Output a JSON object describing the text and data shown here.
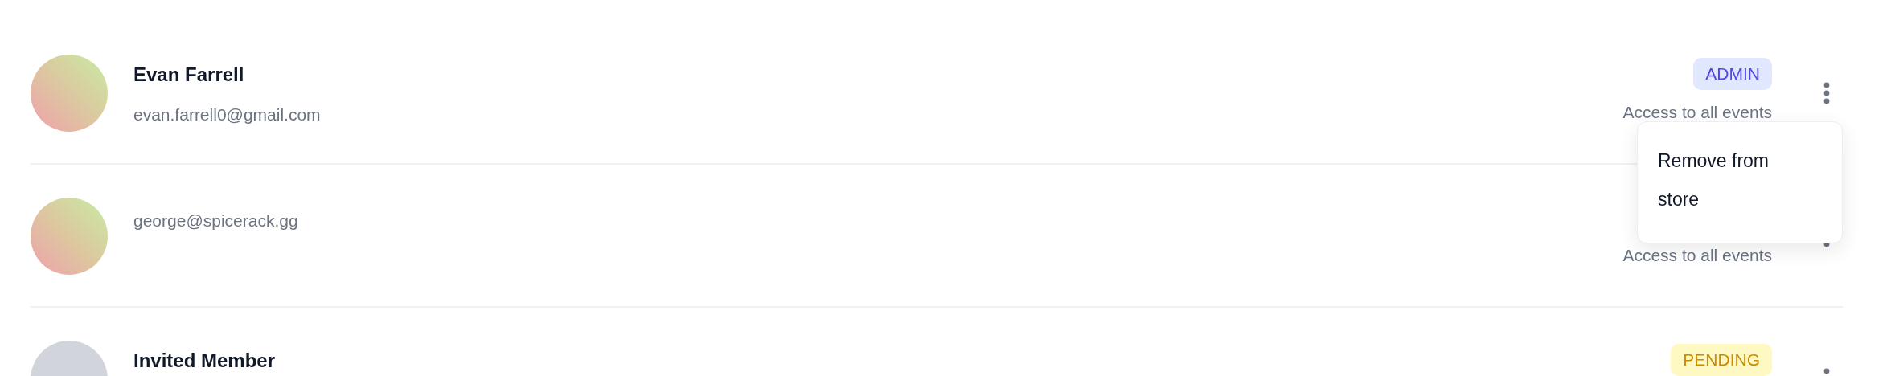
{
  "members": [
    {
      "name": "Evan Farrell",
      "email": "evan.farrell0@gmail.com",
      "avatar": {
        "kind": "gradient"
      },
      "badge": {
        "label": "ADMIN",
        "kind": "admin"
      },
      "access": "Access to all events",
      "menu": [
        "Remove from store"
      ]
    },
    {
      "email": "george@spicerack.gg",
      "avatar": {
        "kind": "gradient"
      },
      "access": "Access to all events"
    },
    {
      "name": "Invited Member",
      "avatar": {
        "kind": "placeholder"
      },
      "badge": {
        "label": "PENDING",
        "kind": "pending"
      }
    }
  ]
}
